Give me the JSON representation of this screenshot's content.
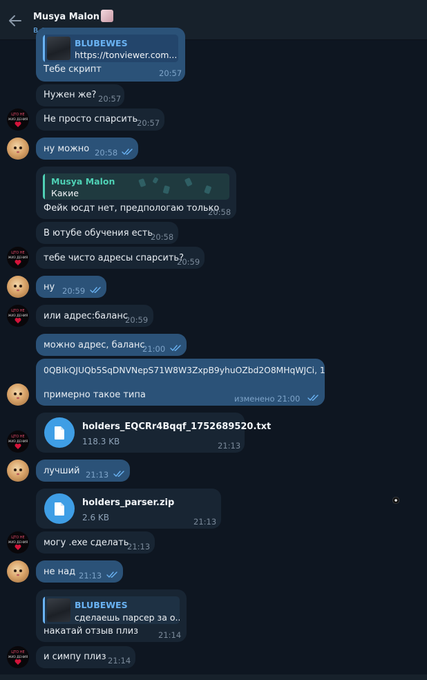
{
  "header": {
    "contact_name": "Musya Malon",
    "status": "в сети",
    "back_icon": "arrow-left-icon"
  },
  "colors": {
    "background": "#0e1621",
    "header": "#17212b",
    "incoming_bubble": "#182533",
    "outgoing_bubble": "#2b5278",
    "accent": "#6ab3f3",
    "file_icon": "#3f9ee5",
    "quote_green": "#4fd1b5"
  },
  "messages": [
    {
      "quote_name": "BLUBEWES",
      "quote_text": "https://tonviewer.com...",
      "text": "Тебе скрипт",
      "time": "20:57"
    },
    {
      "text": "Нужен же?",
      "time": "20:57"
    },
    {
      "text": "Не просто спарсить",
      "time": "20:57"
    },
    {
      "text": "ну можно",
      "time": "20:58"
    },
    {
      "quote_name": "Musya Malon",
      "quote_text": "Какие",
      "text": "Фейк юсдт нет, предпологаю только",
      "time": "20:58"
    },
    {
      "text": "В ютубе обучения есть",
      "time": "20:58"
    },
    {
      "text": "тебе чисто адресы спарсить?",
      "time": "20:59"
    },
    {
      "text": "ну",
      "time": "20:59"
    },
    {
      "text": "или адрес:баланс",
      "time": "20:59"
    },
    {
      "text": "можно адрес, баланс",
      "time": "21:00"
    },
    {
      "line1": "0QBIkQJUQb5SqDNVNepS71W8W3ZxpB9yhuOZbd2O8MHqWJCi, 1",
      "line2": "примерно такое типа",
      "edited_time": "изменено 21:00"
    },
    {
      "file_name": "holders_EQCRr4Bqqf_1752689520.txt",
      "file_size": "118.3 KB",
      "time": "21:13"
    },
    {
      "text": "лучший",
      "time": "21:13"
    },
    {
      "file_name": "holders_parser.zip",
      "file_size": "2.6 KB",
      "time": "21:13"
    },
    {
      "text": "могу .exe сделать",
      "time": "21:13"
    },
    {
      "text": "не над",
      "time": "21:13"
    },
    {
      "quote_name": "BLUBEWES",
      "quote_text": "сделаешь парсер за о...",
      "text": "накатай отзыв плиз",
      "time": "21:14"
    },
    {
      "text": "и симпу плиз",
      "time": "21:14"
    }
  ],
  "avatars": {
    "peer_caption_top": "ЦТО НЕ",
    "peer_caption_bottom": "ЖИЗ ДЕНИЯ"
  }
}
